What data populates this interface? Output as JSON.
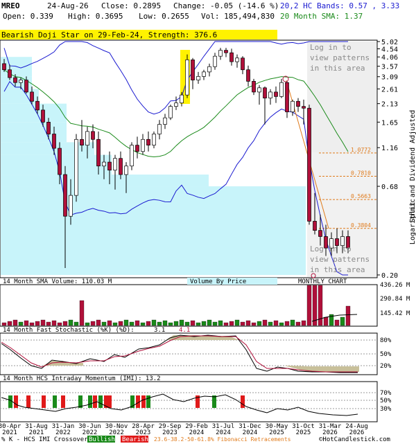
{
  "header": {
    "ticker": "MREO",
    "date": "24-Aug-26",
    "close_label": "Close: 0.2895",
    "change_label": "Change: -0.05 (-14.6 %)",
    "open_label": "Open: 0.339",
    "high_label": "High: 0.3695",
    "low_label": "Low: 0.2655",
    "vol_label": "Vol: 185,494,830",
    "bands_label": "20,2 HC Bands: 0.57 , 3.33",
    "sma_label": "20 Month SMA: 1.37"
  },
  "pattern_banner": "Bearish Doji Star on 29-Feb-24, Strength: 376.6",
  "watermarks": {
    "top_lines": [
      "Log in to",
      "view patterns",
      "in this area"
    ],
    "bottom_lines": [
      "Log in to",
      "view patterns",
      "in this area"
    ]
  },
  "side_labels": {
    "adjusted": "Split and Dividend Adjusted",
    "scale": "Logarithmic"
  },
  "panel_labels": {
    "volume": "14 Month SMA Volume: 110.03 M",
    "volume_by_price": "Volume By Price",
    "chart_type": "MONTHLY CHART",
    "stoch_prefix": "14 Month Fast Stochastic (%K) (%D): ",
    "stoch_values": "3.1",
    "stoch_d": "4.1",
    "imi": "14 Month HCS Intraday Momentum (IMI): 13.2"
  },
  "footer": {
    "legend_text": "% K - HCS IMI Crossover, ",
    "bullish": "Bullish",
    "bearish": "Bearish",
    "fib": "23.6-38.2-50-61.8% Fibonacci Retracements",
    "copyright": "©HotCandlestick.com"
  },
  "colors": {
    "up": "#1a8a1a",
    "down": "#b0103a",
    "band": "#1a1ad0",
    "sma": "#1a8a1a",
    "vbp": "#c8f4fa",
    "highlight": "#fff200",
    "fib": "#e07a1a"
  },
  "chart_data": [
    {
      "type": "candlestick",
      "title": "MREO Monthly",
      "scale": "log",
      "ylim": [
        0.2,
        5.02
      ],
      "y_ticks": [
        "5.02",
        "4.54",
        "4.06",
        "3.57",
        "3.09",
        "2.61",
        "2.13",
        "1.65",
        "1.16",
        "0.68",
        "0.20"
      ],
      "fib_levels": [
        "1.0772",
        "0.7810",
        "0.5663",
        "0.3804"
      ],
      "x_ticks": [
        "30-Apr\n2021",
        "31-Aug\n2021",
        "31-Jan\n2022",
        "30-Jun\n2022",
        "30-Nov\n2022",
        "28-Apr\n2023",
        "29-Sep\n2023",
        "29-Feb\n2024",
        "31-Jul\n2024",
        "31-Dec\n2024",
        "30-May\n2025",
        "31-Oct\n2025",
        "31-Mar\n2026",
        "24-Aug\n2026"
      ],
      "ohlc": [
        [
          3.7,
          3.95,
          3.3,
          3.4
        ],
        [
          3.4,
          3.65,
          2.95,
          3.05
        ],
        [
          3.05,
          3.2,
          2.7,
          2.85
        ],
        [
          2.85,
          3.05,
          2.6,
          2.95
        ],
        [
          2.95,
          3.1,
          2.45,
          2.5
        ],
        [
          2.5,
          2.7,
          2.1,
          2.2
        ],
        [
          2.2,
          2.35,
          1.85,
          1.95
        ],
        [
          1.95,
          2.1,
          1.55,
          1.65
        ],
        [
          1.65,
          1.75,
          1.3,
          1.4
        ],
        [
          1.4,
          1.55,
          1.05,
          1.15
        ],
        [
          1.15,
          1.25,
          0.7,
          0.8
        ],
        [
          0.8,
          0.9,
          0.22,
          0.45
        ],
        [
          0.45,
          0.75,
          0.4,
          0.6
        ],
        [
          0.6,
          1.4,
          0.55,
          1.3
        ],
        [
          1.3,
          1.7,
          1.1,
          1.2
        ],
        [
          1.2,
          1.55,
          1.0,
          1.45
        ],
        [
          1.45,
          1.6,
          1.15,
          1.3
        ],
        [
          1.3,
          1.45,
          0.8,
          0.9
        ],
        [
          0.9,
          1.05,
          0.75,
          0.95
        ],
        [
          0.95,
          1.1,
          0.7,
          0.85
        ],
        [
          0.85,
          1.05,
          0.65,
          1.0
        ],
        [
          1.0,
          1.1,
          0.75,
          0.8
        ],
        [
          0.8,
          0.95,
          0.62,
          0.9
        ],
        [
          0.9,
          1.25,
          0.85,
          1.2
        ],
        [
          1.2,
          1.35,
          1.0,
          1.1
        ],
        [
          1.1,
          1.4,
          1.05,
          1.3
        ],
        [
          1.3,
          1.45,
          1.1,
          1.2
        ],
        [
          1.2,
          1.45,
          1.15,
          1.4
        ],
        [
          1.4,
          1.7,
          1.3,
          1.6
        ],
        [
          1.6,
          1.85,
          1.5,
          1.75
        ],
        [
          1.75,
          2.1,
          1.7,
          2.05
        ],
        [
          2.05,
          2.35,
          1.95,
          2.15
        ],
        [
          2.15,
          2.5,
          2.05,
          2.4
        ],
        [
          2.4,
          4.2,
          2.3,
          3.9
        ],
        [
          3.9,
          4.0,
          2.6,
          2.95
        ],
        [
          2.95,
          3.3,
          2.8,
          3.1
        ],
        [
          3.1,
          3.4,
          2.95,
          3.3
        ],
        [
          3.3,
          3.7,
          3.1,
          3.55
        ],
        [
          3.55,
          4.3,
          3.4,
          4.1
        ],
        [
          4.1,
          4.6,
          3.9,
          4.45
        ],
        [
          4.45,
          4.6,
          4.05,
          4.3
        ],
        [
          4.3,
          4.55,
          3.6,
          3.8
        ],
        [
          3.8,
          4.2,
          3.5,
          4.0
        ],
        [
          4.0,
          4.1,
          3.2,
          3.4
        ],
        [
          3.4,
          3.6,
          2.7,
          2.9
        ],
        [
          2.9,
          3.0,
          2.4,
          2.5
        ],
        [
          2.5,
          2.75,
          2.1,
          2.65
        ],
        [
          2.65,
          2.7,
          1.6,
          2.3
        ],
        [
          2.3,
          2.6,
          2.1,
          2.5
        ],
        [
          2.5,
          2.7,
          2.15,
          2.35
        ],
        [
          2.35,
          3.0,
          2.3,
          2.85
        ],
        [
          2.85,
          2.9,
          1.75,
          1.9
        ],
        [
          1.9,
          2.25,
          1.8,
          2.2
        ],
        [
          2.2,
          2.3,
          1.9,
          2.05
        ],
        [
          2.05,
          2.25,
          1.6,
          2.0
        ],
        [
          2.0,
          2.1,
          0.4,
          0.42
        ],
        [
          0.42,
          0.62,
          0.35,
          0.37
        ],
        [
          0.37,
          0.46,
          0.3,
          0.34
        ],
        [
          0.34,
          0.4,
          0.26,
          0.29
        ],
        [
          0.29,
          0.36,
          0.26,
          0.33
        ],
        [
          0.33,
          0.38,
          0.27,
          0.3
        ],
        [
          0.3,
          0.37,
          0.27,
          0.34
        ],
        [
          0.34,
          0.37,
          0.27,
          0.29
        ]
      ]
    }
  ]
}
